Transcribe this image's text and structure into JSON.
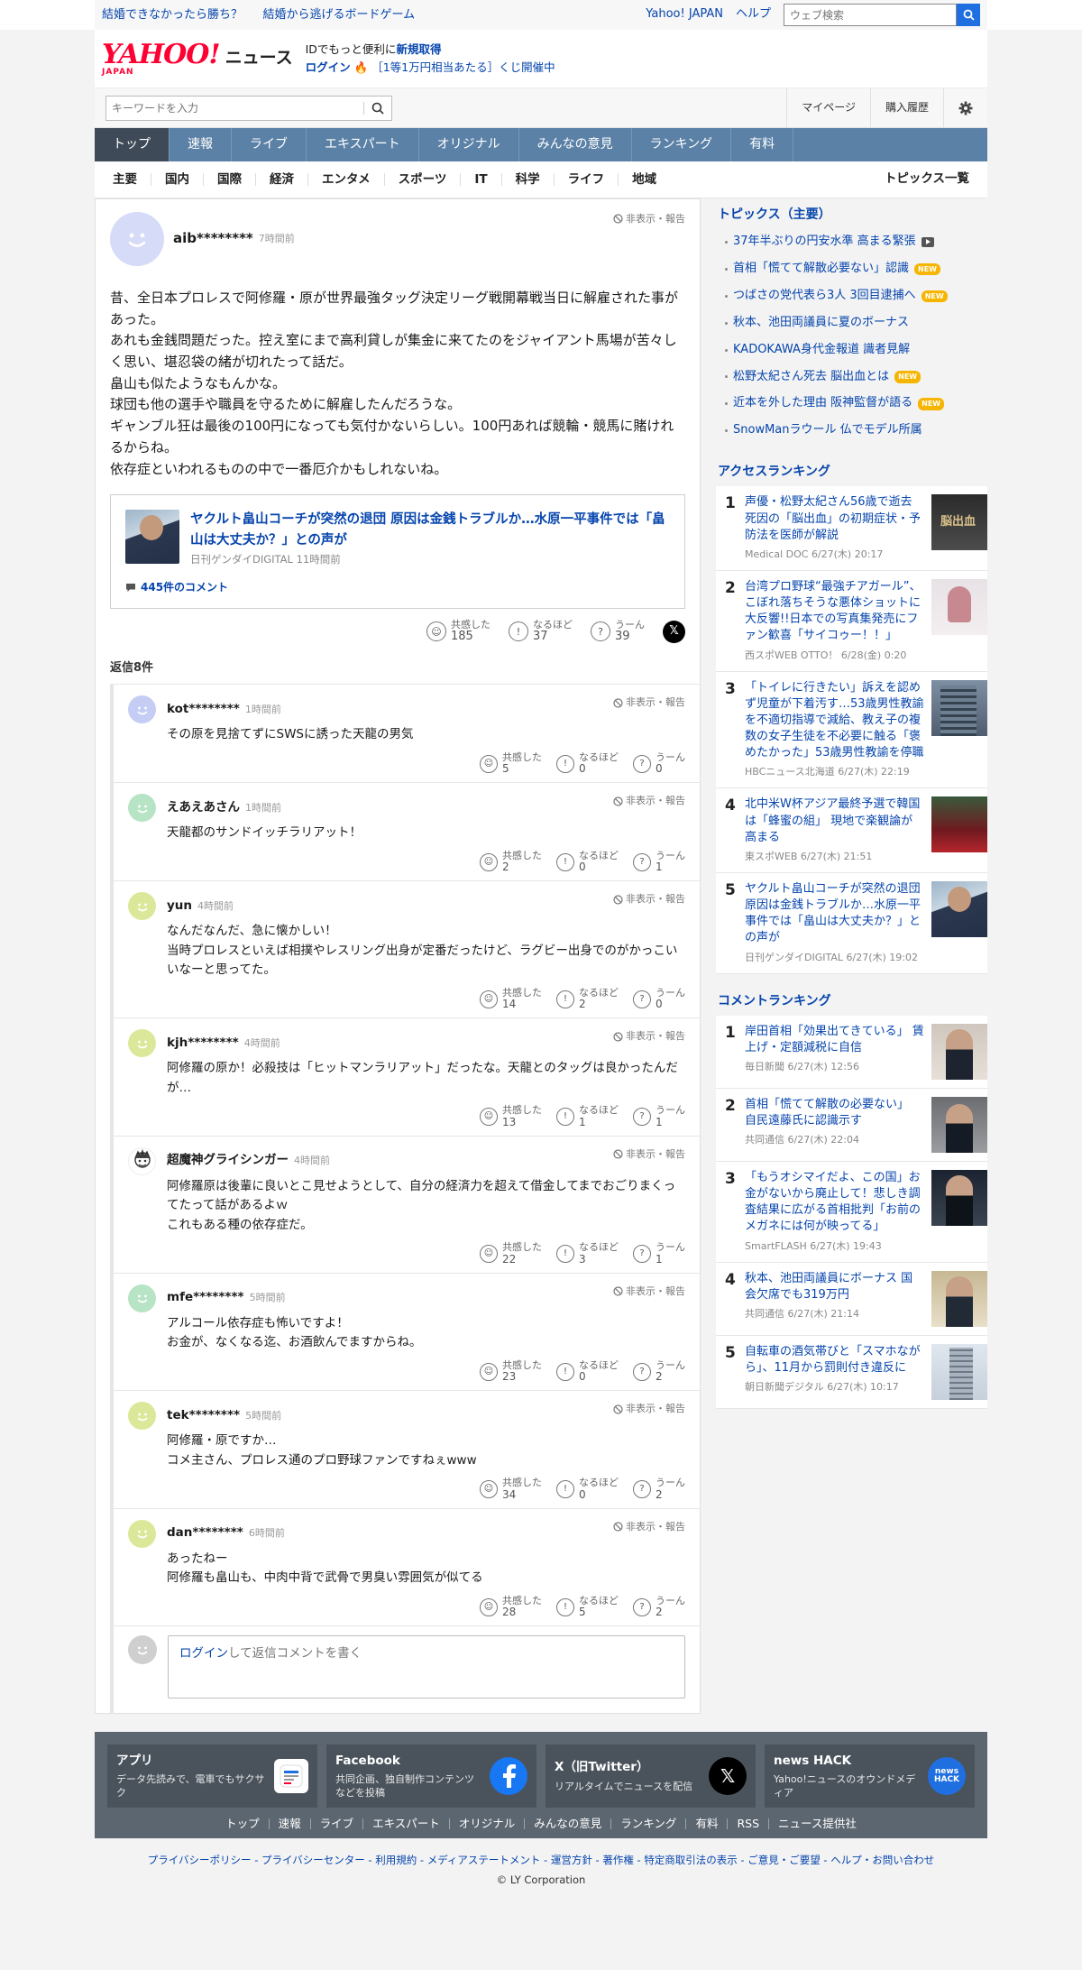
{
  "topbar": {
    "promo_links": [
      "結婚できなかったら勝ち？",
      "結婚から逃げるボードゲーム"
    ],
    "yahoo_japan": "Yahoo! JAPAN",
    "help": "ヘルプ",
    "web_search_placeholder": "ウェブ検索"
  },
  "brand": {
    "logo": "YAHOO!",
    "logo_sub": "JAPAN",
    "service": "ニュース",
    "id_promo_prefix": "IDでもっと便利に",
    "id_promo_link": "新規取得",
    "login": "ログイン",
    "lottery": "［1等1万円相当あたる］くじ開催中"
  },
  "search": {
    "placeholder": "キーワードを入力",
    "mypage": "マイページ",
    "history": "購入履歴"
  },
  "mainnav": [
    "トップ",
    "速報",
    "ライブ",
    "エキスパート",
    "オリジナル",
    "みんなの意見",
    "ランキング",
    "有料"
  ],
  "catnav": {
    "items": [
      "主要",
      "国内",
      "国際",
      "経済",
      "エンタメ",
      "スポーツ",
      "IT",
      "科学",
      "ライフ",
      "地域"
    ],
    "all_topics": "トピックス一覧"
  },
  "main_comment": {
    "user": "aib********",
    "time": "7時間前",
    "hide_report": "非表示・報告",
    "lines": [
      "昔、全日本プロレスで阿修羅・原が世界最強タッグ決定リーグ戦開幕戦当日に解雇された事があった。",
      "あれも金銭問題だった。控え室にまで高利貸しが集金に来てたのをジャイアント馬場が苦々しく思い、堪忍袋の緒が切れたって話だ。",
      "畠山も似たようなもんかな。",
      "球団も他の選手や職員を守るために解雇したんだろうな。",
      "ギャンブル狂は最後の100円になっても気付かないらしい。100円あれば競輪・競馬に賭けれるからね。",
      "依存症といわれるものの中で一番厄介かもしれないね。"
    ],
    "article": {
      "title": "ヤクルト畠山コーチが突然の退団 原因は金銭トラブルか…水原一平事件では「畠山は大丈夫か？」との声が",
      "source": "日刊ゲンダイDIGITAL 11時間前",
      "comments": "445件のコメント"
    },
    "reactions": {
      "empathy_label": "共感した",
      "empathy": "185",
      "agree_label": "なるほど",
      "agree": "37",
      "hmm_label": "うーん",
      "hmm": "39"
    }
  },
  "replies_header": "返信8件",
  "replies": [
    {
      "user": "kot********",
      "time": "1時間前",
      "lines": [
        "その原を見捨てずにSWSに誘った天龍の男気"
      ],
      "empathy": "5",
      "agree": "0",
      "hmm": "0",
      "avatar_color": "#c5cdf5"
    },
    {
      "user": "えあえあさん",
      "time": "1時間前",
      "lines": [
        "天龍都のサンドイッチラリアット！"
      ],
      "empathy": "2",
      "agree": "0",
      "hmm": "1",
      "avatar_color": "#b7e4c4"
    },
    {
      "user": "yun",
      "time": "4時間前",
      "lines": [
        "なんだなんだ、急に懐かしい！",
        "当時プロレスといえば相撲やレスリング出身が定番だったけど、ラグビー出身でのがかっこいいなーと思ってた。"
      ],
      "empathy": "14",
      "agree": "2",
      "hmm": "0",
      "avatar_color": "#dbe89a"
    },
    {
      "user": "kjh********",
      "time": "4時間前",
      "lines": [
        "阿修羅の原か！必殺技は「ヒットマンラリアット」だったな。天龍とのタッグは良かったんだが…"
      ],
      "empathy": "13",
      "agree": "1",
      "hmm": "1",
      "avatar_color": "#dbe89a"
    },
    {
      "user": "超魔神グライシンガー",
      "time": "4時間前",
      "lines": [
        "阿修羅原は後輩に良いとこ見せようとして、自分の経済力を超えて借金してまでおごりまくってたって話があるよｗ",
        "これもある種の依存症だ。"
      ],
      "empathy": "22",
      "agree": "3",
      "hmm": "1",
      "avatar_color": "#ffffff"
    },
    {
      "user": "mfe********",
      "time": "5時間前",
      "lines": [
        "アルコール依存症も怖いですよ！",
        "お金が、なくなる迄、お酒飲んでますからね。"
      ],
      "empathy": "23",
      "agree": "0",
      "hmm": "2",
      "avatar_color": "#b7e4c4"
    },
    {
      "user": "tek********",
      "time": "5時間前",
      "lines": [
        "阿修羅・原ですか…",
        "コメ主さん、プロレス通のプロ野球ファンですねぇwww"
      ],
      "empathy": "34",
      "agree": "0",
      "hmm": "2",
      "avatar_color": "#dbe89a"
    },
    {
      "user": "dan********",
      "time": "6時間前",
      "lines": [
        "あったねー",
        "阿修羅も畠山も、中肉中背で武骨で男臭い雰囲気が似てる"
      ],
      "empathy": "28",
      "agree": "5",
      "hmm": "2",
      "avatar_color": "#dbe89a"
    }
  ],
  "reply_form": {
    "login": "ログイン",
    "text": "して返信コメントを書く"
  },
  "topics": {
    "title": "トピックス（主要）",
    "items": [
      {
        "text": "37年半ぶりの円安水準 高まる緊張",
        "badge": "video"
      },
      {
        "text": "首相「慌てて解散必要ない」認識",
        "badge": "NEW"
      },
      {
        "text": "つばさの党代表ら3人 3回目逮捕へ",
        "badge": "NEW"
      },
      {
        "text": "秋本、池田両議員に夏のボーナス",
        "badge": ""
      },
      {
        "text": "KADOKAWA身代金報道 識者見解",
        "badge": ""
      },
      {
        "text": "松野太紀さん死去 脳出血とは",
        "badge": "NEW"
      },
      {
        "text": "近本を外した理由 阪神監督が語る",
        "badge": "NEW"
      },
      {
        "text": "SnowManラウール 仏でモデル所属",
        "badge": ""
      }
    ]
  },
  "access_ranking": {
    "title": "アクセスランキング",
    "items": [
      {
        "no": "1",
        "title": "声優・松野太紀さん56歳で逝去 死因の「脳出血」の初期症状・予防法を医師が解説",
        "src": "Medical DOC 6/27(木) 20:17",
        "img": "img-book"
      },
      {
        "no": "2",
        "title": "台湾プロ野球“最強チアガール”、こぼれ落ちそうな悪体ショットに大反響!!日本での写真集発売にファン歓喜「サイコゥー！！」",
        "src": "西スポWEB OTTO！ 6/28(金) 0:20",
        "img": "img-girl"
      },
      {
        "no": "3",
        "title": "「トイレに行きたい」訴えを認めず児童が下着汚す…53歳男性教諭を不適切指導で減給、教え子の複数の女子生徒を不必要に触る「褒めたかった」53歳男性教諭を停職",
        "src": "HBCニュース北海道 6/27(木) 22:19",
        "img": "img-bldg"
      },
      {
        "no": "4",
        "title": "北中米W杯アジア最終予選で韓国は「蜂蜜の組」 現地で楽観論が高まる",
        "src": "東スポWEB 6/27(木) 21:51",
        "img": "img-soccer"
      },
      {
        "no": "5",
        "title": "ヤクルト畠山コーチが突然の退団 原因は金銭トラブルか…水原一平事件では「畠山は大丈夫か？」との声が",
        "src": "日刊ゲンダイDIGITAL 6/27(木) 19:02",
        "img": "img-baseball2"
      }
    ]
  },
  "comment_ranking": {
    "title": "コメントランキング",
    "items": [
      {
        "no": "1",
        "title": "岸田首相「効果出てきている」 賃上げ・定額減税に自信",
        "src": "毎日新聞 6/27(木) 12:56",
        "img": "img-suit"
      },
      {
        "no": "2",
        "title": "首相「慌てて解散の必要ない」 自民遠藤氏に認識示す",
        "src": "共同通信 6/27(木) 22:04",
        "img": "img-suit2"
      },
      {
        "no": "3",
        "title": "「もうオシマイだよ、この国」お金がないから廃止して！悲しき調査結果に広がる首相批判「お前のメガネには何が映ってる」",
        "src": "SmartFLASH 6/27(木) 19:43",
        "img": "img-suit3"
      },
      {
        "no": "4",
        "title": "秋本、池田両議員にボーナス 国会欠席でも319万円",
        "src": "共同通信 6/27(木) 21:14",
        "img": "img-suit4"
      },
      {
        "no": "5",
        "title": "自転車の酒気帯びと「スマホながら」、11月から罰則付き違反に",
        "src": "朝日新聞デジタル 6/27(木) 10:17",
        "img": "img-tower"
      }
    ]
  },
  "footer": {
    "cards": [
      {
        "title": "アプリ",
        "desc": "データ先読みで、電車でもサクサク"
      },
      {
        "title": "Facebook",
        "desc": "共同企画、独自制作コンテンツなどを投稿"
      },
      {
        "title": "X（旧Twitter）",
        "desc": "リアルタイムでニュースを配信"
      },
      {
        "title": "news HACK",
        "desc": "Yahoo!ニュースのオウンドメディア"
      }
    ],
    "links": [
      "トップ",
      "速報",
      "ライブ",
      "エキスパート",
      "オリジナル",
      "みんなの意見",
      "ランキング",
      "有料",
      "RSS",
      "ニュース提供社"
    ],
    "legal": "プライバシーポリシー - プライバシーセンター - 利用規約 - メディアステートメント - 運営方針 - 著作権 - 特定商取引法の表示 - ご意見・ご要望 - ヘルプ・お問い合わせ",
    "copyright": "© LY Corporation"
  }
}
